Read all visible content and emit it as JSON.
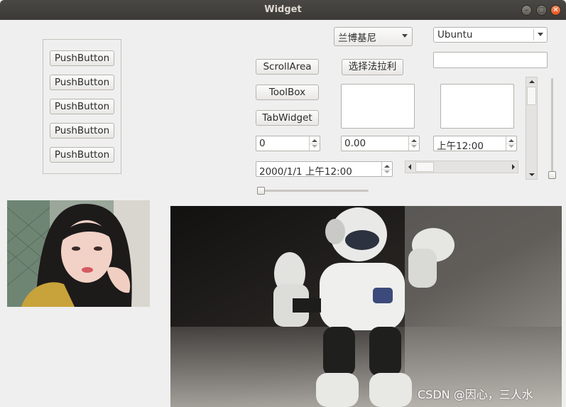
{
  "window": {
    "title": "Widget"
  },
  "left_group": {
    "buttons": [
      "PushButton",
      "PushButton",
      "PushButton",
      "PushButton",
      "PushButton"
    ]
  },
  "buttons": {
    "scroll_area": "ScrollArea",
    "toolbox": "ToolBox",
    "tab_widget": "TabWidget",
    "select_ferrari": "选择法拉利"
  },
  "combos": {
    "car": "兰博基尼",
    "os": "Ubuntu"
  },
  "spin_int": "0",
  "spin_double": "0.00",
  "time_edit": "上午12:00",
  "datetime_edit": "2000/1/1 上午12:00",
  "watermark": "CSDN @因心，三人水",
  "colors": {
    "titlebar": "#3b3a36",
    "close_button": "#e0531c",
    "background": "#efefef"
  }
}
